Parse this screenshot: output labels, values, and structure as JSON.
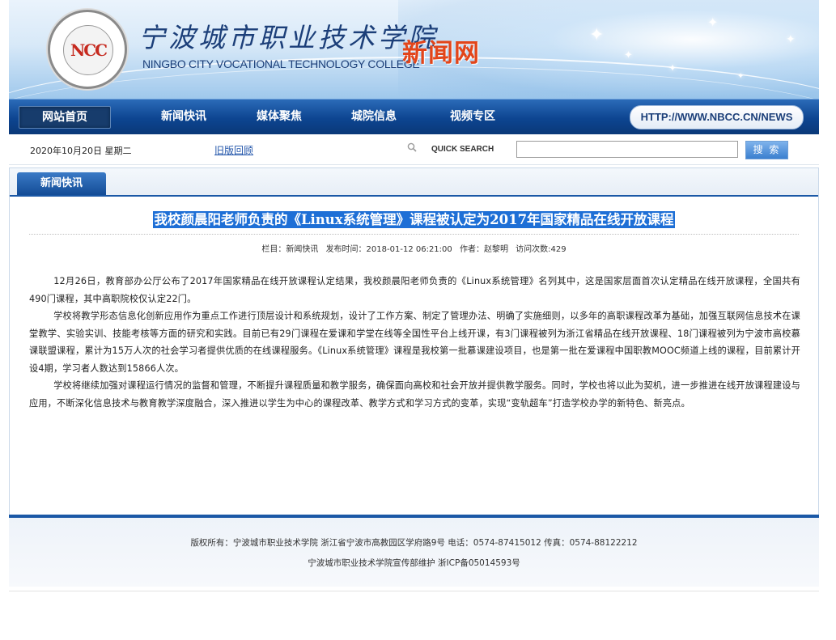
{
  "header": {
    "logo_text": "NCC",
    "school_name_cn": "宁波城市职业技术学院",
    "school_name_en": "NINGBO CITY VOCATIONAL TECHNOLOGY COLLEGE",
    "site_name": "新闻网"
  },
  "nav": {
    "items": [
      {
        "label": "网站首页",
        "active": true
      },
      {
        "label": "新闻快讯",
        "active": false
      },
      {
        "label": "媒体聚焦",
        "active": false
      },
      {
        "label": "城院信息",
        "active": false
      },
      {
        "label": "视频专区",
        "active": false
      }
    ],
    "url": "HTTP://WWW.NBCC.CN/NEWS"
  },
  "infobar": {
    "date": "2020年10月20日 星期二",
    "old_site_link": "旧版回顾",
    "quick_search_label": "QUICK SEARCH",
    "search_value": "",
    "search_button": "搜 索"
  },
  "section_tab": "新闻快讯",
  "article": {
    "title": "我校颜晨阳老师负责的《Linux系统管理》课程被认定为2017年国家精品在线开放课程",
    "meta": {
      "column": "栏目：新闻快讯",
      "published": "发布时间：2018-01-12 06:21:00",
      "author": "作者：赵黎明",
      "views": "访问次数:429"
    },
    "paragraphs": [
      "12月26日，教育部办公厅公布了2017年国家精品在线开放课程认定结果，我校颜晨阳老师负责的《Linux系统管理》名列其中，这是国家层面首次认定精品在线开放课程，全国共有490门课程，其中高职院校仅认定22门。",
      "学校将教学形态信息化创新应用作为重点工作进行顶层设计和系统规划，设计了工作方案、制定了管理办法、明确了实施细则，以多年的高职课程改革为基础，加强互联网信息技术在课堂教学、实验实训、技能考核等方面的研究和实践。目前已有29门课程在爱课和学堂在线等全国性平台上线开课，有3门课程被列为浙江省精品在线开放课程、18门课程被列为宁波市高校慕课联盟课程，累计为15万人次的社会学习者提供优质的在线课程服务。《Linux系统管理》课程是我校第一批慕课建设项目，也是第一批在爱课程中国职教MOOC频道上线的课程，目前累计开设4期，学习者人数达到15866人次。",
      "学校将继续加强对课程运行情况的监督和管理，不断提升课程质量和教学服务，确保面向高校和社会开放并提供教学服务。同时，学校也将以此为契机，进一步推进在线开放课程建设与应用，不断深化信息技术与教育教学深度融合，深入推进以学生为中心的课程改革、教学方式和学习方式的变革，实现“变轨超车”打造学校办学的新特色、新亮点。"
    ]
  },
  "footer": {
    "line1": "版权所有：宁波城市职业技术学院 浙江省宁波市高教园区学府路9号 电话：0574-87415012 传真：0574-88122212",
    "line2": "宁波城市职业技术学院宣传部维护 浙ICP备05014593号"
  },
  "colors": {
    "nav_blue": "#0d4591",
    "headline_highlight": "#1e6fd6",
    "site_name_orange": "#e2451a"
  }
}
